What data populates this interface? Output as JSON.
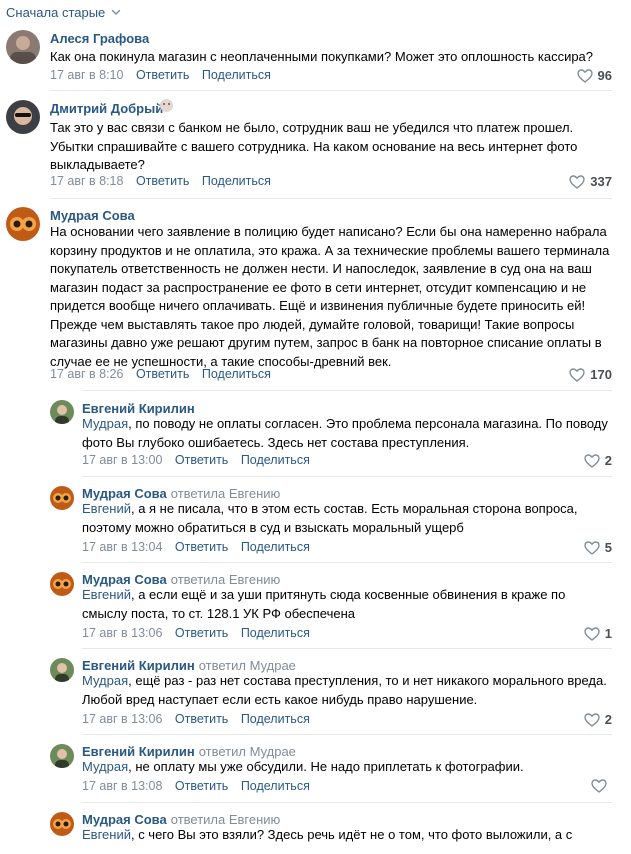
{
  "sort": {
    "label": "Сначала старые"
  },
  "comments": [
    {
      "author": "Алеся Графова",
      "text": "Как она покинула магазин с неоплаченными покупками? Может это оплошность кассира?",
      "time": "17 авг в 8:10",
      "reply_label": "Ответить",
      "share_label": "Поделиться",
      "likes": "96"
    },
    {
      "author": "Дмитрий Добрый",
      "text": "Так это у вас связи с банком не было, сотрудник ваш не убедился что платеж прошел. Убытки спрашивайте с вашего сотрудника. На каком основание на весь интернет фото выкладываете?",
      "time": "17 авг в 8:18",
      "reply_label": "Ответить",
      "share_label": "Поделиться",
      "likes": "337"
    },
    {
      "author": "Мудрая Сова",
      "text": "На основании чего заявление в полицию будет написано? Если бы она намеренно набрала корзину продуктов и не оплатила, это кража. А за технические проблемы вашего терминала покупатель ответственность не должен нести. И напоследок, заявление в суд она на ваш магазин подаст за распространение ее фото в сети интернет, отсудит компенсацию и не придется вообще ничего оплачивать. Ещё и извинения публичные будете приносить ей! Прежде чем выставлять такое про людей, думайте головой, товарищи! Такие вопросы магазины давно уже решают другим путем, запрос в банк на повторное списание оплаты в случае ее не успешности, а такие способы-древний век.",
      "time": "17 авг в 8:26",
      "reply_label": "Ответить",
      "share_label": "Поделиться",
      "likes": "170"
    }
  ],
  "replies": [
    {
      "author": "Евгений Кирилин",
      "replied_to": "",
      "mention": "Мудрая",
      "text": ", по поводу не оплаты согласен. Это проблема персонала магазина. По поводу фото Вы глубоко ошибаетесь. Здесь нет состава преступления.",
      "time": "17 авг в 13:00",
      "reply_label": "Ответить",
      "share_label": "Поделиться",
      "likes": "2"
    },
    {
      "author": "Мудрая Сова",
      "replied_to": "ответила Евгению",
      "mention": "Евгений",
      "text": ", а я не писала, что в этом есть состав. Есть моральная сторона вопроса, поэтому можно обратиться в суд и взыскать моральный ущерб",
      "time": "17 авг в 13:04",
      "reply_label": "Ответить",
      "share_label": "Поделиться",
      "likes": "5"
    },
    {
      "author": "Мудрая Сова",
      "replied_to": "ответила Евгению",
      "mention": "Евгений",
      "text": ", а если ещё и за уши притянуть сюда косвенные обвинения в краже по смыслу поста, то ст. 128.1 УК РФ обеспечена",
      "time": "17 авг в 13:06",
      "reply_label": "Ответить",
      "share_label": "Поделиться",
      "likes": "1"
    },
    {
      "author": "Евгений Кирилин",
      "replied_to": "ответил Мудрае",
      "mention": "Мудрая",
      "text": ", ещё раз - раз нет состава преступления, то и нет никакого морального вреда. Любой вред наступает если есть какое нибудь право нарушение.",
      "time": "17 авг в 13:06",
      "reply_label": "Ответить",
      "share_label": "Поделиться",
      "likes": "2"
    },
    {
      "author": "Евгений Кирилин",
      "replied_to": "ответил Мудрае",
      "mention": "Мудрая",
      "text": ", не оплату мы уже обсудили. Не надо приплетать к фотографии.",
      "time": "17 авг в 13:08",
      "reply_label": "Ответить",
      "share_label": "Поделиться",
      "likes": ""
    },
    {
      "author": "Мудрая Сова",
      "replied_to": "ответила Евгению",
      "mention": "Евгений",
      "text": ", с чего Вы это взяли? Здесь речь идёт не о том, что фото выложили, а с",
      "time": "",
      "reply_label": "",
      "share_label": "",
      "likes": ""
    }
  ],
  "colors": {
    "link": "#2a5885",
    "meta": "#818c99",
    "divider": "#e7e8ec"
  },
  "icons": [
    "chevron-down-icon",
    "heart-icon"
  ]
}
